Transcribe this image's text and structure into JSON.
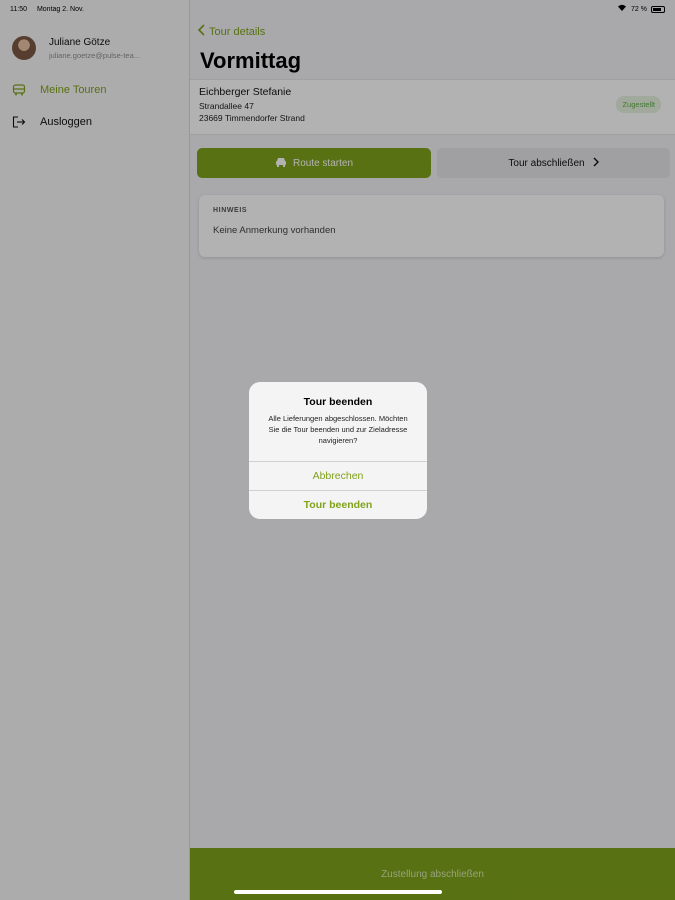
{
  "status_bar": {
    "time": "11:50",
    "date": "Montag 2. Nov.",
    "battery": "72 %"
  },
  "sidebar": {
    "user_name": "Juliane Götze",
    "user_email": "juliane.goetze@pulse-tea...",
    "items": [
      {
        "label": "Meine Touren",
        "icon": "bus-icon"
      },
      {
        "label": "Ausloggen",
        "icon": "logout-icon"
      }
    ]
  },
  "nav": {
    "back_label": "Tour details",
    "title": "Vormittag"
  },
  "customer": {
    "name": "Eichberger Stefanie",
    "street": "Strandallee 47",
    "city": "23669 Timmendorfer Strand",
    "status": "Zugestellt"
  },
  "actions": {
    "route_label": "Route starten",
    "finish_label": "Tour abschließen"
  },
  "note": {
    "label": "HINWEIS",
    "text": "Keine Anmerkung vorhanden"
  },
  "bottom": {
    "label": "Zustellung abschließen"
  },
  "alert": {
    "title": "Tour beenden",
    "message": "Alle Lieferungen abgeschlossen. Möchten Sie die Tour beenden und zur Zieladresse navigieren?",
    "cancel_label": "Abbrechen",
    "confirm_label": "Tour beenden"
  },
  "colors": {
    "accent": "#7fa21a",
    "background": "#f2f2f7",
    "badge_bg": "#e5f3e0",
    "badge_text": "#5fae46"
  }
}
